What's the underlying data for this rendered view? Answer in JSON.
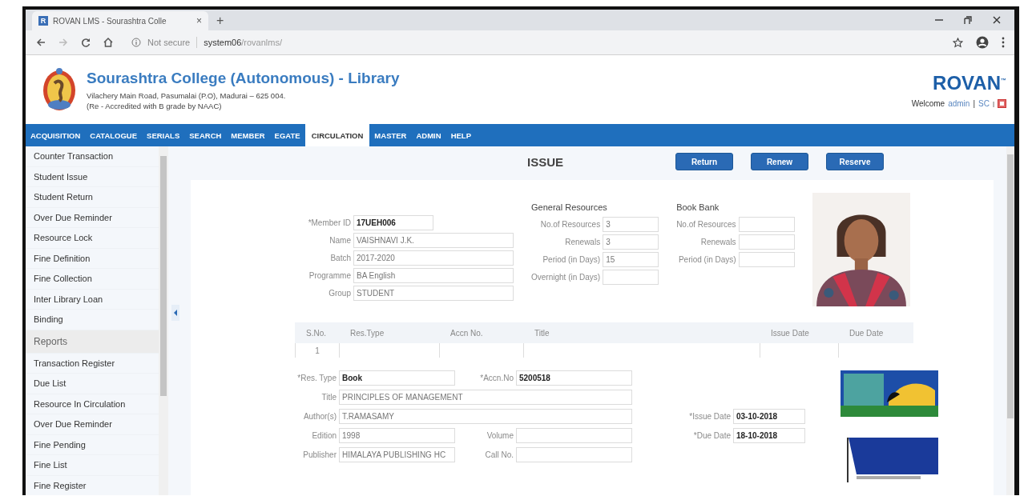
{
  "browser": {
    "favicon_letter": "R",
    "tab_title": "ROVAN LMS - Sourashtra Colle",
    "tab_close": "×",
    "new_tab": "+",
    "security": "Not secure",
    "url_host": "system06",
    "url_path": "/rovanlms/"
  },
  "header": {
    "title": "Sourashtra College (Autonomous) - Library",
    "address": "Vilachery Main Road, Pasumalai (P.O), Madurai – 625 004.",
    "accreditation": "(Re - Accredited with B grade by NAAC)",
    "brand": "ROVAN$^{™}$",
    "welcome": "Welcome",
    "user": "admin",
    "separator": "|",
    "site": "SC"
  },
  "menu": [
    {
      "label": "ACQUISITION",
      "selected": false
    },
    {
      "label": "CATALOGUE",
      "selected": false
    },
    {
      "label": "SERIALS",
      "selected": false
    },
    {
      "label": "SEARCH",
      "selected": false
    },
    {
      "label": "MEMBER",
      "selected": false
    },
    {
      "label": "EGATE",
      "selected": false
    },
    {
      "label": "CIRCULATION",
      "selected": true
    },
    {
      "label": "MASTER",
      "selected": false
    },
    {
      "label": "ADMIN",
      "selected": false
    },
    {
      "label": "HELP",
      "selected": false
    }
  ],
  "sidebar": {
    "items": [
      {
        "label": "Counter Transaction",
        "kind": "item"
      },
      {
        "label": "Student Issue",
        "kind": "item"
      },
      {
        "label": "Student Return",
        "kind": "item"
      },
      {
        "label": "Over Due Reminder",
        "kind": "item"
      },
      {
        "label": "Resource Lock",
        "kind": "item"
      },
      {
        "label": "Fine Definition",
        "kind": "item"
      },
      {
        "label": "Fine Collection",
        "kind": "item"
      },
      {
        "label": "Inter Library Loan",
        "kind": "item"
      },
      {
        "label": "Binding",
        "kind": "item"
      },
      {
        "label": "Reports",
        "kind": "heading"
      },
      {
        "label": "Transaction Register",
        "kind": "item"
      },
      {
        "label": "Due List",
        "kind": "item"
      },
      {
        "label": "Resource In Circulation",
        "kind": "item"
      },
      {
        "label": "Over Due Reminder",
        "kind": "item"
      },
      {
        "label": "Fine Pending",
        "kind": "item"
      },
      {
        "label": "Fine List",
        "kind": "item"
      },
      {
        "label": "Fine Register",
        "kind": "item"
      }
    ]
  },
  "page": {
    "title": "ISSUE",
    "buttons": [
      "Return",
      "Renew",
      "Reserve"
    ]
  },
  "member": [
    {
      "label": "*Member ID",
      "value": "17UEH006",
      "bold": true
    },
    {
      "label": "Name",
      "value": "VAISHNAVI J.K.",
      "bold": false
    },
    {
      "label": "Batch",
      "value": "2017-2020",
      "bold": false
    },
    {
      "label": "Programme",
      "value": "BA English",
      "bold": false
    },
    {
      "label": "Group",
      "value": "STUDENT",
      "bold": false
    }
  ],
  "general_resources": {
    "title": "General Resources",
    "fields": [
      {
        "label": "No.of Resources",
        "value": "3"
      },
      {
        "label": "Renewals",
        "value": "3"
      },
      {
        "label": "Period (in Days)",
        "value": "15"
      },
      {
        "label": "Overnight (in Days)"
      }
    ]
  },
  "book_bank": {
    "title": "Book Bank",
    "fields": [
      {
        "label": "No.of Resources"
      },
      {
        "label": "Renewals"
      },
      {
        "label": "Period (in Days)"
      }
    ]
  },
  "table": {
    "columns": [
      "S.No.",
      "Res.Type",
      "Accn No.",
      "Title",
      "Issue Date",
      "Due Date"
    ],
    "rows": [
      {
        "cells": [
          "1"
        ]
      }
    ]
  },
  "resource_form": [
    {
      "fields": [
        {
          "label": "*Res. Type",
          "value": "Book",
          "bold": true
        },
        {
          "label": "*Accn.No",
          "value": "5200518",
          "bold": true
        }
      ]
    },
    {
      "fields": [
        {
          "label": "Title",
          "value": "PRINCIPLES OF MANAGEMENT",
          "bold": false
        }
      ]
    },
    {
      "fields": [
        {
          "label": "Author(s)",
          "value": "T.RAMASAMY",
          "bold": false
        },
        {
          "label": "*Issue Date",
          "value": "03-10-2018",
          "bold": true
        }
      ]
    },
    {
      "fields": [
        {
          "label": "Edition",
          "value": "1998",
          "bold": false
        },
        {
          "label": "Volume"
        },
        {
          "label": "*Due Date",
          "value": "18-10-2018",
          "bold": true
        }
      ]
    },
    {
      "fields": [
        {
          "label": "Publisher",
          "value": "HIMALAYA  PUBLISHING HC",
          "bold": false
        },
        {
          "label": "Call No."
        }
      ]
    }
  ]
}
